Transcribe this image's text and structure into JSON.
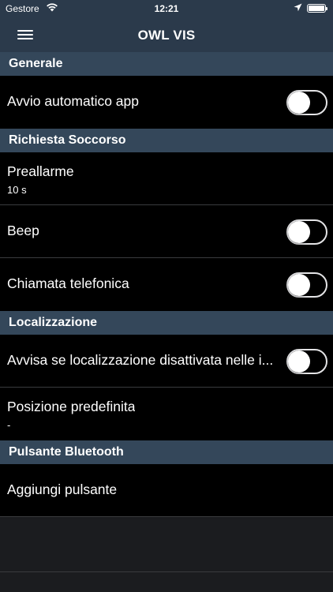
{
  "status_bar": {
    "carrier": "Gestore",
    "time": "12:21",
    "icons": [
      "wifi-icon",
      "location-arrow-icon",
      "battery-icon"
    ]
  },
  "nav": {
    "title": "OWL VIS",
    "menu_icon": "hamburger-menu-icon"
  },
  "sections": {
    "generale": {
      "header": "Generale",
      "avvio_label": "Avvio automatico app",
      "avvio_on": false
    },
    "soccorso": {
      "header": "Richiesta Soccorso",
      "preallarme_label": "Preallarme",
      "preallarme_value": "10 s",
      "beep_label": "Beep",
      "beep_on": false,
      "chiamata_label": "Chiamata telefonica",
      "chiamata_on": false
    },
    "localizzazione": {
      "header": "Localizzazione",
      "avvisa_label": "Avvisa se localizzazione disattivata nelle i...",
      "avvisa_on": false,
      "posizione_label": "Posizione predefinita",
      "posizione_value": "-"
    },
    "bluetooth": {
      "header": "Pulsante Bluetooth",
      "aggiungi_label": "Aggiungi pulsante"
    }
  },
  "colors": {
    "header_bg": "#2b3a4b",
    "section_bg": "#34475a",
    "row_bg": "#000000",
    "toggle_border": "#e4e4e6"
  }
}
